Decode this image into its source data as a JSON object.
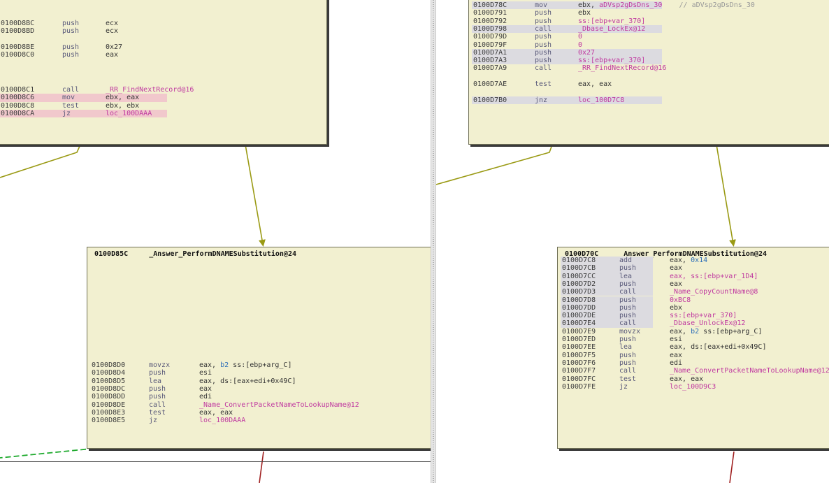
{
  "left_graph": {
    "top_block": {
      "rows": [
        {
          "addr": "0100D8BC",
          "mn": "push",
          "op": [
            {
              "t": "ecx",
              "c": "opd"
            }
          ],
          "hl": ""
        },
        {
          "addr": "0100D8BD",
          "mn": "push",
          "op": [
            {
              "t": "ecx",
              "c": "opd"
            }
          ],
          "hl": ""
        },
        {
          "addr": "0100D8BE",
          "mn": "push",
          "op": [
            {
              "t": "0x27",
              "c": "opd"
            }
          ],
          "hl": ""
        },
        {
          "addr": "0100D8C0",
          "mn": "push",
          "op": [
            {
              "t": "eax",
              "c": "opd"
            }
          ],
          "hl": ""
        },
        {
          "addr": "0100D8C1",
          "mn": "call",
          "op": [
            {
              "t": "_RR_FindNextRecord@16",
              "c": "sym"
            }
          ],
          "hl": ""
        },
        {
          "addr": "0100D8C6",
          "mn": "mov",
          "op": [
            {
              "t": "ebx, eax",
              "c": "opd"
            }
          ],
          "hl": "pink"
        },
        {
          "addr": "0100D8C8",
          "mn": "test",
          "op": [
            {
              "t": "ebx, ebx",
              "c": "opd"
            }
          ],
          "hl": ""
        },
        {
          "addr": "0100D8CA",
          "mn": "jz",
          "op": [
            {
              "t": "loc_100DAAA",
              "c": "sym"
            }
          ],
          "hl": "pink"
        }
      ]
    },
    "bottom_block": {
      "title": "0100D85C     _Answer_PerformDNAMESubstitution@24",
      "rows": [
        {
          "addr": "0100D8D0",
          "mn": "movzx",
          "op": [
            {
              "t": "eax, ",
              "c": "opd"
            },
            {
              "t": "b2 ",
              "c": "num"
            },
            {
              "t": "ss:[ebp+arg_C]",
              "c": "opd"
            }
          ],
          "hl": ""
        },
        {
          "addr": "0100D8D4",
          "mn": "push",
          "op": [
            {
              "t": "esi",
              "c": "opd"
            }
          ],
          "hl": ""
        },
        {
          "addr": "0100D8D5",
          "mn": "lea",
          "op": [
            {
              "t": "eax, ds:[eax+edi+0x49C]",
              "c": "opd"
            }
          ],
          "hl": ""
        },
        {
          "addr": "0100D8DC",
          "mn": "push",
          "op": [
            {
              "t": "eax",
              "c": "opd"
            }
          ],
          "hl": ""
        },
        {
          "addr": "0100D8DD",
          "mn": "push",
          "op": [
            {
              "t": "edi",
              "c": "opd"
            }
          ],
          "hl": ""
        },
        {
          "addr": "0100D8DE",
          "mn": "call",
          "op": [
            {
              "t": "_Name_ConvertPacketNameToLookupName@12",
              "c": "sym"
            }
          ],
          "hl": ""
        },
        {
          "addr": "0100D8E3",
          "mn": "test",
          "op": [
            {
              "t": "eax, eax",
              "c": "opd"
            }
          ],
          "hl": ""
        },
        {
          "addr": "0100D8E5",
          "mn": "jz",
          "op": [
            {
              "t": "loc_100DAAA",
              "c": "sym"
            }
          ],
          "hl": ""
        }
      ]
    }
  },
  "right_graph": {
    "top_block": {
      "rows": [
        {
          "addr": "0100D78C",
          "mn": "mov",
          "op": [
            {
              "t": "ebx, ",
              "c": "opd"
            },
            {
              "t": "aDVsp2gDsDns_30",
              "c": "sym"
            },
            {
              "t": "    // aDVsp2gDsDns_30",
              "c": "cmt"
            }
          ],
          "hl": "gray"
        },
        {
          "addr": "0100D791",
          "mn": "push",
          "op": [
            {
              "t": "ebx",
              "c": "opd"
            }
          ],
          "hl": ""
        },
        {
          "addr": "0100D792",
          "mn": "push",
          "op": [
            {
              "t": "ss:[ebp+var_370]",
              "c": "sym"
            }
          ],
          "hl": ""
        },
        {
          "addr": "0100D798",
          "mn": "call",
          "op": [
            {
              "t": "_Dbase_LockEx@12",
              "c": "sym"
            }
          ],
          "hl": "gray"
        },
        {
          "addr": "0100D79D",
          "mn": "push",
          "op": [
            {
              "t": "0",
              "c": "sym"
            }
          ],
          "hl": ""
        },
        {
          "addr": "0100D79F",
          "mn": "push",
          "op": [
            {
              "t": "0",
              "c": "sym"
            }
          ],
          "hl": ""
        },
        {
          "addr": "0100D7A1",
          "mn": "push",
          "op": [
            {
              "t": "0x27",
              "c": "sym"
            }
          ],
          "hl": "gray"
        },
        {
          "addr": "0100D7A3",
          "mn": "push",
          "op": [
            {
              "t": "ss:[ebp+var_370]",
              "c": "sym"
            }
          ],
          "hl": "gray"
        },
        {
          "addr": "0100D7A9",
          "mn": "call",
          "op": [
            {
              "t": "_RR_FindNextRecord@16",
              "c": "sym"
            }
          ],
          "hl": ""
        },
        {
          "addr": "0100D7AE",
          "mn": "test",
          "op": [
            {
              "t": "eax, eax",
              "c": "opd"
            }
          ],
          "hl": ""
        },
        {
          "addr": "0100D7B0",
          "mn": "jnz",
          "op": [
            {
              "t": "loc_100D7C8",
              "c": "sym"
            }
          ],
          "hl": "gray"
        }
      ]
    },
    "bottom_block": {
      "title": "0100D70C     _Answer_PerformDNAMESubstitution@24",
      "rows": [
        {
          "addr": "0100D7C8",
          "mn": "add",
          "op": [
            {
              "t": "eax, ",
              "c": "opd"
            },
            {
              "t": "0x14",
              "c": "num"
            }
          ],
          "hl": "gray"
        },
        {
          "addr": "0100D7CB",
          "mn": "push",
          "op": [
            {
              "t": "eax",
              "c": "opd"
            }
          ],
          "hl": "gray"
        },
        {
          "addr": "0100D7CC",
          "mn": "lea",
          "op": [
            {
              "t": "eax, ss:[ebp+var_1D4]",
              "c": "sym"
            }
          ],
          "hl": "gray"
        },
        {
          "addr": "0100D7D2",
          "mn": "push",
          "op": [
            {
              "t": "eax",
              "c": "opd"
            }
          ],
          "hl": "gray"
        },
        {
          "addr": "0100D7D3",
          "mn": "call",
          "op": [
            {
              "t": "_Name_CopyCountName@8",
              "c": "sym"
            }
          ],
          "hl": "gray"
        },
        {
          "addr": "0100D7D8",
          "mn": "push",
          "op": [
            {
              "t": "0xBC8",
              "c": "sym"
            }
          ],
          "hl": "gray"
        },
        {
          "addr": "0100D7DD",
          "mn": "push",
          "op": [
            {
              "t": "ebx",
              "c": "opd"
            }
          ],
          "hl": "gray"
        },
        {
          "addr": "0100D7DE",
          "mn": "push",
          "op": [
            {
              "t": "ss:[ebp+var_370]",
              "c": "sym"
            }
          ],
          "hl": "gray"
        },
        {
          "addr": "0100D7E4",
          "mn": "call",
          "op": [
            {
              "t": "_Dbase_UnlockEx@12",
              "c": "sym"
            }
          ],
          "hl": "gray"
        },
        {
          "addr": "0100D7E9",
          "mn": "movzx",
          "op": [
            {
              "t": "eax, ",
              "c": "opd"
            },
            {
              "t": "b2 ",
              "c": "num"
            },
            {
              "t": "ss:[ebp+arg_C]",
              "c": "opd"
            }
          ],
          "hl": ""
        },
        {
          "addr": "0100D7ED",
          "mn": "push",
          "op": [
            {
              "t": "esi",
              "c": "opd"
            }
          ],
          "hl": ""
        },
        {
          "addr": "0100D7EE",
          "mn": "lea",
          "op": [
            {
              "t": "eax, ds:[eax+edi+0x49C]",
              "c": "opd"
            }
          ],
          "hl": ""
        },
        {
          "addr": "0100D7F5",
          "mn": "push",
          "op": [
            {
              "t": "eax",
              "c": "opd"
            }
          ],
          "hl": ""
        },
        {
          "addr": "0100D7F6",
          "mn": "push",
          "op": [
            {
              "t": "edi",
              "c": "opd"
            }
          ],
          "hl": ""
        },
        {
          "addr": "0100D7F7",
          "mn": "call",
          "op": [
            {
              "t": "_Name_ConvertPacketNameToLookupName@12",
              "c": "sym"
            }
          ],
          "hl": ""
        },
        {
          "addr": "0100D7FC",
          "mn": "test",
          "op": [
            {
              "t": "eax, eax",
              "c": "opd"
            }
          ],
          "hl": ""
        },
        {
          "addr": "0100D7FE",
          "mn": "jz",
          "op": [
            {
              "t": "loc_100D9C3",
              "c": "sym"
            }
          ],
          "hl": ""
        }
      ]
    }
  },
  "colors": {
    "block_bg": "#f2f0d0",
    "edge_olive": "#9a9a14",
    "edge_green_dashed": "#1faa2e",
    "edge_red": "#a02020",
    "highlight_gray": "#dcdbe0",
    "highlight_pink": "#f1c8cc"
  }
}
